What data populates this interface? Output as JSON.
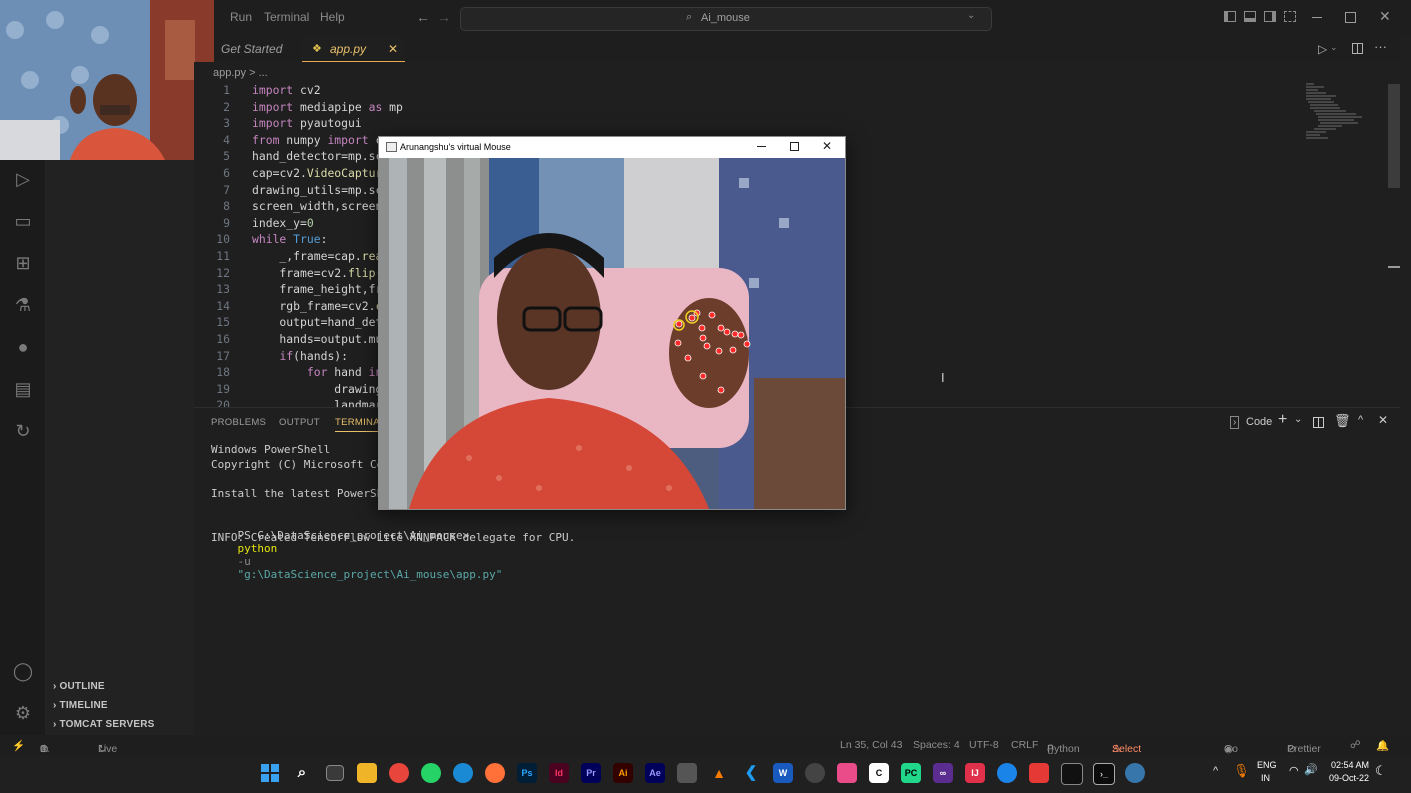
{
  "menu": [
    "Run",
    "Terminal",
    "Help"
  ],
  "search": {
    "text": "Ai_mouse"
  },
  "tabs": [
    {
      "label": "Get Started",
      "active": false
    },
    {
      "label": "app.py",
      "active": true
    }
  ],
  "breadcrumb": "app.py > ...",
  "code_lines": [
    {
      "n": "1",
      "html": "<span class='kw'>import</span> cv2"
    },
    {
      "n": "2",
      "html": "<span class='kw'>import</span> mediapipe <span class='kw'>as</span> mp"
    },
    {
      "n": "3",
      "html": "<span class='kw'>import</span> pyautogui"
    },
    {
      "n": "4",
      "html": "<span class='kw'>from</span> numpy <span class='kw'>import</span> c"
    },
    {
      "n": "5",
      "html": "hand_detector<span>=</span>mp.sc"
    },
    {
      "n": "6",
      "html": "cap<span>=</span>cv2.<span class='fn'>VideoCaptur</span>"
    },
    {
      "n": "7",
      "html": "drawing_utils<span>=</span>mp.sc"
    },
    {
      "n": "8",
      "html": "screen_width,screen"
    },
    {
      "n": "9",
      "html": "index_y<span>=</span><span class='num'>0</span>"
    },
    {
      "n": "10",
      "html": "<span class='kw'>while</span> <span class='kb'>True</span>:"
    },
    {
      "n": "11",
      "html": "    _,frame<span>=</span>cap.<span class='fn'>rea</span>"
    },
    {
      "n": "12",
      "html": "    frame<span>=</span>cv2.<span class='fn'>flip(</span>"
    },
    {
      "n": "13",
      "html": "    frame_height,fr"
    },
    {
      "n": "14",
      "html": "    rgb_frame<span>=</span>cv2.<span class='fn'>c</span>"
    },
    {
      "n": "15",
      "html": "    output<span>=</span>hand_det"
    },
    {
      "n": "16",
      "html": "    hands<span>=</span>output.mu"
    },
    {
      "n": "17",
      "html": "    <span class='kw'>if</span>(hands):"
    },
    {
      "n": "18",
      "html": "        <span class='kw'>for</span> hand <span class='kw'>in</span>"
    },
    {
      "n": "19",
      "html": "            drawing"
    },
    {
      "n": "20",
      "html": "            landmar"
    }
  ],
  "sidebar_sections": [
    "OUTLINE",
    "TIMELINE",
    "TOMCAT SERVERS"
  ],
  "panel_tabs": [
    "PROBLEMS",
    "OUTPUT",
    "TERMINAL"
  ],
  "panel_terminal_label": "Code",
  "terminal": {
    "line1": "Windows PowerShell",
    "line2": "Copyright (C) Microsoft Co",
    "line3": "Install the latest PowerSh",
    "prompt": "PS G:\\DataScience_project\\Ai_mouse>",
    "cmd": "python",
    "flag": "-u",
    "arg": "\"g:\\DataScience_project\\Ai_mouse\\app.py\"",
    "info": "INFO: Created TensorFlow Lite XNNPACK delegate for CPU."
  },
  "cv_window": {
    "title": "Arunangshu's virtual Mouse"
  },
  "status": {
    "errors": "0",
    "warnings": "0",
    "live_share": "Live Share",
    "position": "Ln 35, Col 43",
    "spaces": "Spaces: 4",
    "encoding": "UTF-8",
    "eol": "CRLF",
    "language": "Python",
    "interpreter": "Select Interpreter",
    "go_live": "Go Live",
    "prettier": "Prettier"
  },
  "taskbar": {
    "lang1": "ENG",
    "lang2": "IN",
    "time": "02:54 AM",
    "date": "09-Oct-22",
    "apps": [
      {
        "name": "ps-app-icon",
        "label": "Ps",
        "color": "#001e36",
        "fg": "#31a8ff"
      },
      {
        "name": "id-app-icon",
        "label": "Id",
        "color": "#49021f",
        "fg": "#ff3366"
      },
      {
        "name": "pr-app-icon",
        "label": "Pr",
        "color": "#00005b",
        "fg": "#9999ff"
      },
      {
        "name": "ai-app-icon",
        "label": "Ai",
        "color": "#330000",
        "fg": "#ff9a00"
      },
      {
        "name": "ae-app-icon",
        "label": "Ae",
        "color": "#00005b",
        "fg": "#9999ff"
      }
    ]
  }
}
